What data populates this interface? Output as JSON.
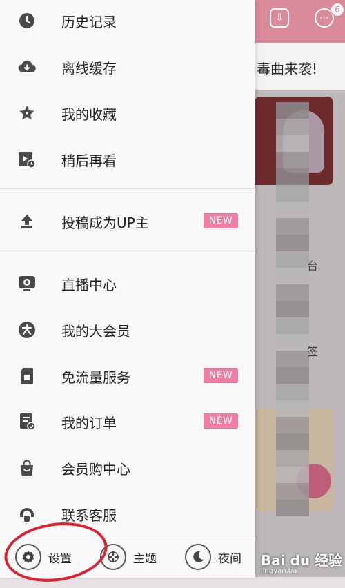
{
  "background": {
    "ticker": "毒曲来袭!",
    "badge_count": "6",
    "side_texts": [
      "台",
      "签"
    ],
    "watermark": "Bai du 经验",
    "watermark_url": "jingyan.ba"
  },
  "drawer": {
    "group1": [
      {
        "label": "历史记录",
        "icon": "clock-icon"
      },
      {
        "label": "离线缓存",
        "icon": "cloud-download-icon"
      },
      {
        "label": "我的收藏",
        "icon": "star-icon"
      },
      {
        "label": "稍后再看",
        "icon": "watch-later-icon"
      }
    ],
    "group2": [
      {
        "label": "投稿成为UP主",
        "icon": "upload-icon",
        "badge": "NEW"
      }
    ],
    "group3": [
      {
        "label": "直播中心",
        "icon": "live-tv-icon"
      },
      {
        "label": "我的大会员",
        "icon": "vip-icon"
      },
      {
        "label": "免流量服务",
        "icon": "sim-card-icon",
        "badge": "NEW"
      },
      {
        "label": "我的订单",
        "icon": "order-icon",
        "badge": "NEW"
      },
      {
        "label": "会员购中心",
        "icon": "shopping-bag-icon"
      },
      {
        "label": "联系客服",
        "icon": "headset-icon"
      }
    ]
  },
  "bottom_bar": {
    "settings": "设置",
    "theme": "主题",
    "night": "夜间"
  },
  "colors": {
    "accent": "#f07ca0",
    "annotation": "#e02030",
    "icon": "#4a4a4a"
  }
}
